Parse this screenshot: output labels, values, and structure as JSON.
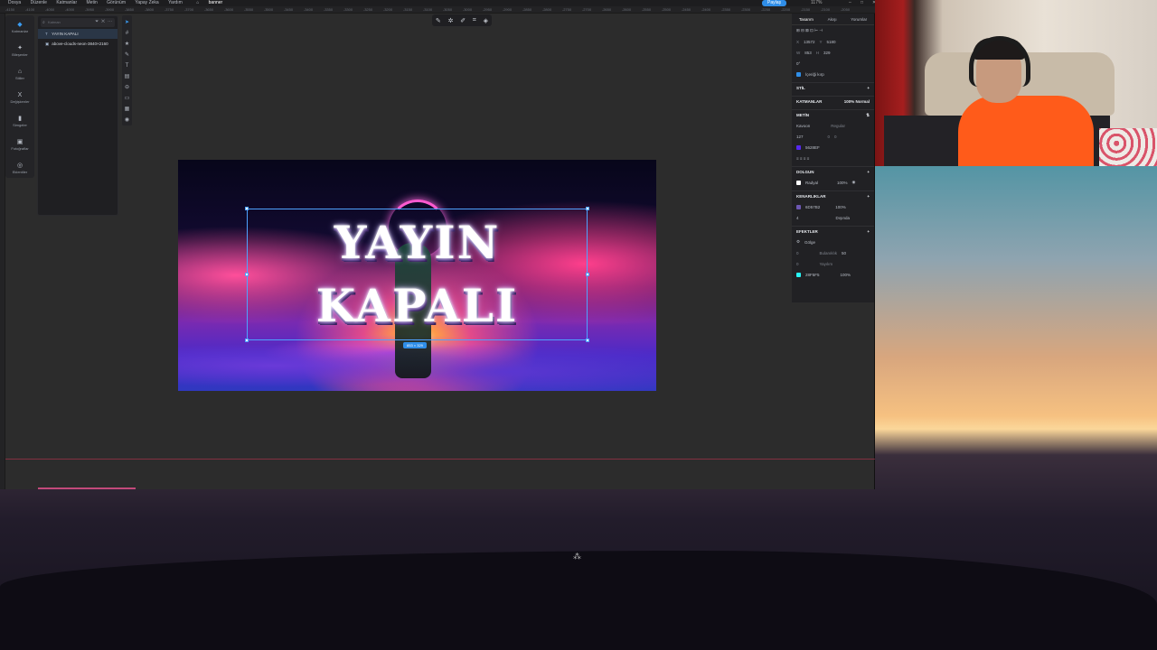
{
  "menubar": {
    "items": [
      "Dosya",
      "Düzenle",
      "Katmanlar",
      "Metin",
      "Görünüm",
      "Yapay Zeka",
      "Yardım"
    ],
    "doc_tab": "banner",
    "share_label": "Paylaş",
    "zoom": "117%"
  },
  "ruler": [
    "-4150",
    "-4100",
    "-4050",
    "-4000",
    "-3950",
    "-3900",
    "-3850",
    "-3800",
    "-3750",
    "-3700",
    "-3650",
    "-3600",
    "-3550",
    "-3500",
    "-3450",
    "-3400",
    "-3350",
    "-3300",
    "-3250",
    "-3200",
    "-3150",
    "-3100",
    "-3050",
    "-3000",
    "-2950",
    "-2900",
    "-2850",
    "-2800",
    "-2750",
    "-2700",
    "-2650",
    "-2600",
    "-2550",
    "-2500",
    "-2450",
    "-2400",
    "-2350",
    "-2300",
    "-2250",
    "-2200",
    "-2150",
    "-2100",
    "-2050"
  ],
  "rail": [
    {
      "icon": "◆",
      "label": "Katmanlar"
    },
    {
      "icon": "✦",
      "label": "Bileşenler"
    },
    {
      "icon": "⌂",
      "label": "Stiller"
    },
    {
      "icon": "X",
      "label": "Değişkenler"
    },
    {
      "icon": "▮",
      "label": "Simgeler"
    },
    {
      "icon": "▣",
      "label": "Fotoğraflar"
    },
    {
      "icon": "◎",
      "label": "Eklentiler"
    }
  ],
  "layers": {
    "search_placeholder": "Katman",
    "rows": [
      {
        "icon": "T",
        "label": "YAYIN KAPALI"
      },
      {
        "icon": "▣",
        "label": "above-clouds-neon-3840×2160"
      }
    ]
  },
  "artwork": {
    "line1": "YAYIN",
    "line2": "KAPALI"
  },
  "selection_size": "853 × 329",
  "props": {
    "tabs": [
      "Tasarım",
      "Akışı",
      "Yorumlar"
    ],
    "x_label": "X",
    "x": "13572",
    "y_label": "Y",
    "y": "5180",
    "w_label": "W",
    "w": "853",
    "h_label": "H",
    "h": "329",
    "rotation": "0°",
    "clip_label": "İçeriği kırp",
    "style_label": "STİL",
    "layer_label": "KATMANLAR",
    "opacity": "100%",
    "blend": "Normal",
    "text_label": "METİN",
    "font": "Kavoon",
    "weight": "Regular",
    "font_size": "127",
    "letter": "0",
    "line": "0",
    "text_color": "5628EF",
    "fill_label": "DOLGUN",
    "fill_value": "Radyal",
    "fill_pct": "100%",
    "stroke_label": "KENARLIKLAR",
    "stroke_color": "6D57B2",
    "stroke_pct": "100%",
    "stroke_w": "4",
    "stroke_pos": "Dışında",
    "effects_label": "EFEKTLER",
    "effect_name": "Gölge",
    "blur_label": "Bulanıklık",
    "blur": "50",
    "spread_label": "Yayılım",
    "ex": "0",
    "ey": "0",
    "shadow_color": "28F5F5",
    "shadow_pct": "100%"
  },
  "colors": {
    "accent": "#2f8ee8",
    "text_swatch": "#5628EF",
    "stroke_swatch": "#6D57B2",
    "shadow_swatch": "#28F5F5"
  }
}
